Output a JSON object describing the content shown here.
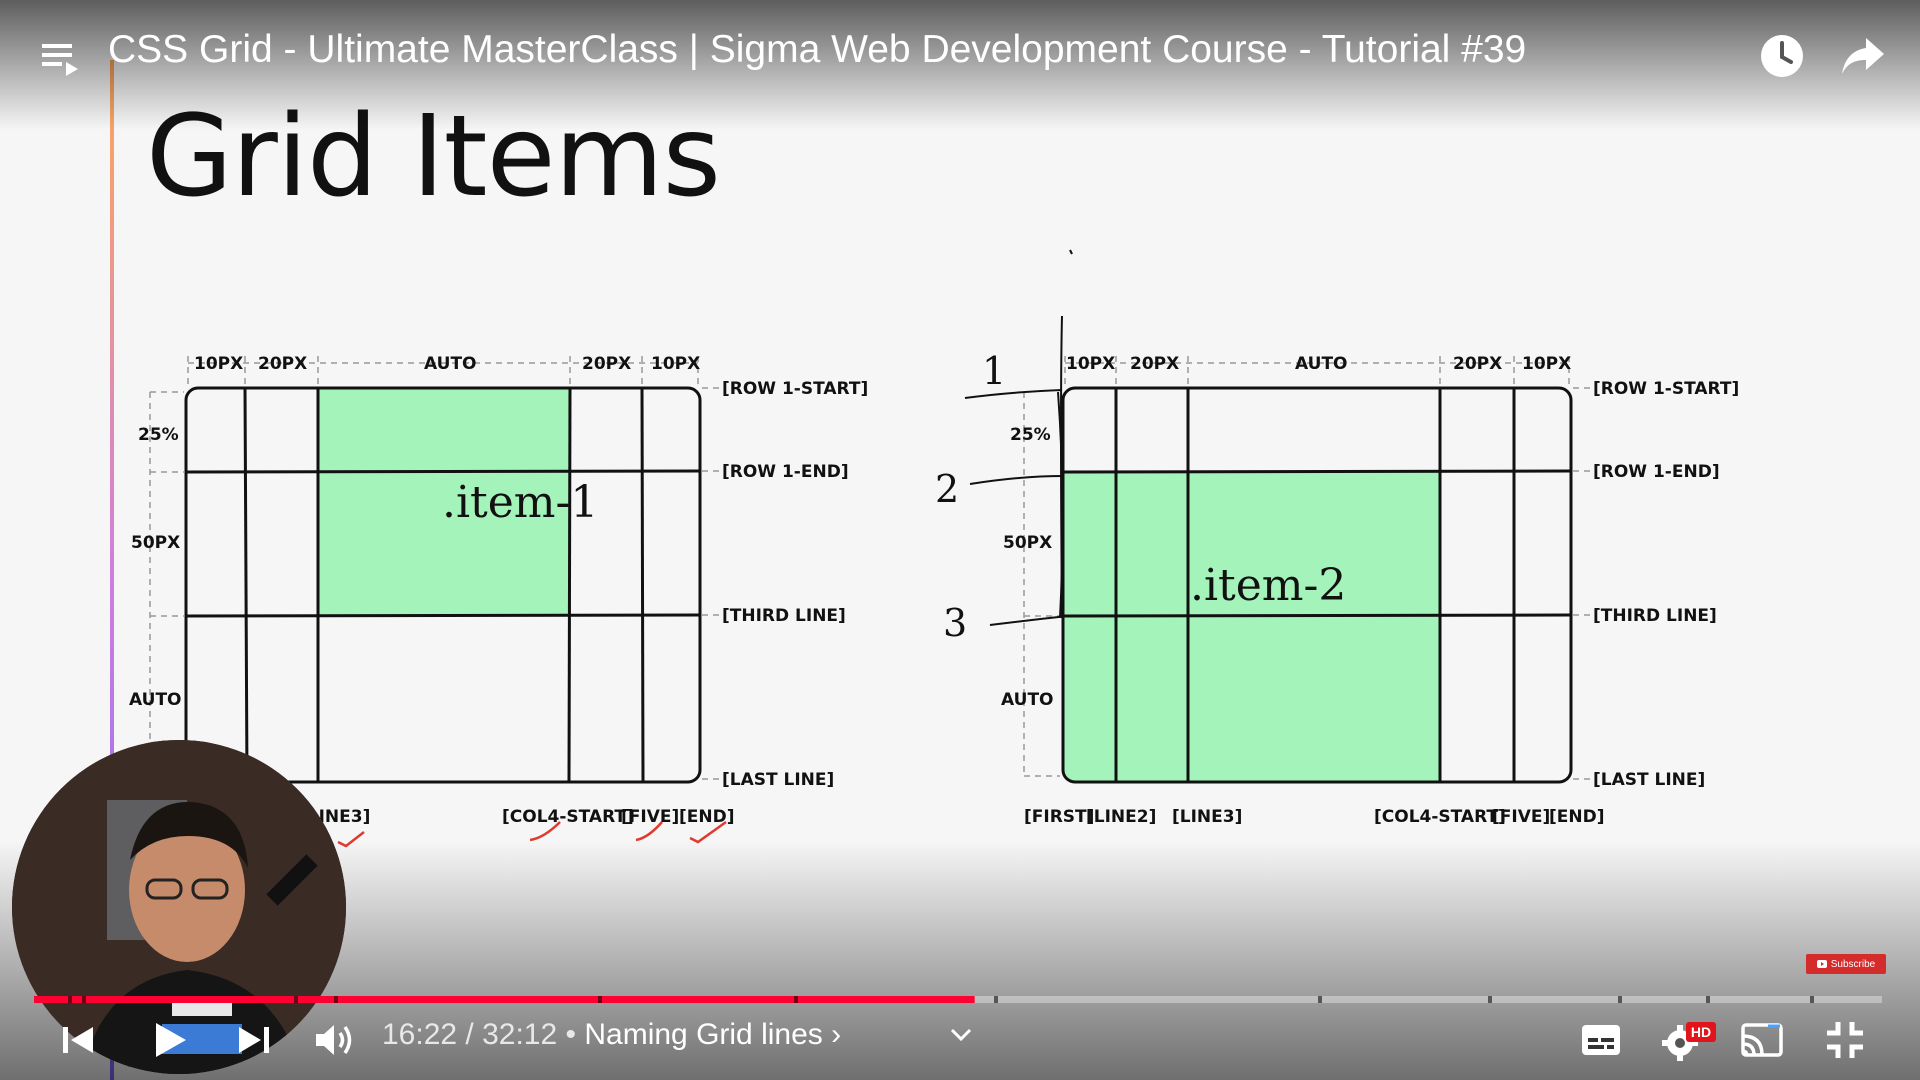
{
  "player": {
    "video_title": "CSS Grid - Ultimate MasterClass | Sigma Web Development Course - Tutorial #39",
    "current_time": "16:22",
    "separator": " / ",
    "duration": "32:12",
    "chapter_bullet": " • ",
    "chapter_title": "Naming Grid lines",
    "chapter_arrow": "›",
    "progress_fraction": 0.509,
    "hd_badge": "HD",
    "subscribe_label": "Subscribe",
    "accent_color": "#ff0033",
    "icons": [
      "playlist-icon",
      "watch-later-icon",
      "share-icon",
      "previous-icon",
      "play-icon",
      "next-icon",
      "volume-icon",
      "chevron-down-icon",
      "subtitles-icon",
      "settings-icon",
      "cast-icon",
      "exit-fullscreen-icon"
    ]
  },
  "slide": {
    "title": "Grid Items",
    "item_fill_color": "#a3f3bb",
    "left": {
      "item_label": ".item-1",
      "col_sizes": [
        "10PX",
        "20PX",
        "AUTO",
        "20PX",
        "10PX"
      ],
      "row_sizes": [
        "25%",
        "50PX",
        "AUTO"
      ],
      "row_lines": [
        "[ROW 1-START]",
        "[ROW 1-END]",
        "[THIRD LINE]",
        "[LAST LINE]"
      ],
      "col_lines": [
        "[LINE3]",
        "[COL4-START]",
        "[FIVE]",
        "[END]"
      ]
    },
    "right": {
      "item_label": ".item-2",
      "col_sizes": [
        "10PX",
        "20PX",
        "AUTO",
        "20PX",
        "10PX"
      ],
      "row_sizes": [
        "25%",
        "50PX",
        "AUTO"
      ],
      "row_lines": [
        "[ROW 1-START]",
        "[ROW 1-END]",
        "[THIRD LINE]",
        "[LAST LINE]"
      ],
      "col_lines": [
        "[FIRST]",
        "[LINE2]",
        "[LINE3]",
        "[COL4-START]",
        "[FIVE]",
        "[END]"
      ],
      "handwritten_numbers": [
        "1",
        "2",
        "3"
      ]
    }
  }
}
